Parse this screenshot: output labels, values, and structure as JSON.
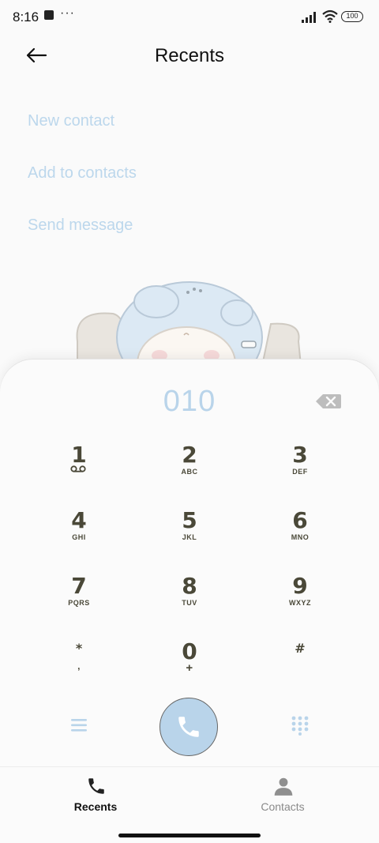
{
  "status_bar": {
    "time": "8:16",
    "more": "···",
    "battery": "100"
  },
  "header": {
    "title": "Recents",
    "back_icon": "arrow-left-icon"
  },
  "actions": [
    {
      "label": "New contact"
    },
    {
      "label": "Add to contacts"
    },
    {
      "label": "Send message"
    }
  ],
  "dialer": {
    "number": "010",
    "keys": [
      {
        "digit": "1",
        "sub": "",
        "icon": "voicemail-icon"
      },
      {
        "digit": "2",
        "sub": "ABC"
      },
      {
        "digit": "3",
        "sub": "DEF"
      },
      {
        "digit": "4",
        "sub": "GHI"
      },
      {
        "digit": "5",
        "sub": "JKL"
      },
      {
        "digit": "6",
        "sub": "MNO"
      },
      {
        "digit": "7",
        "sub": "PQRS"
      },
      {
        "digit": "8",
        "sub": "TUV"
      },
      {
        "digit": "9",
        "sub": "WXYZ"
      },
      {
        "digit": "*",
        "sub": ","
      },
      {
        "digit": "0",
        "sub": "+"
      },
      {
        "digit": "#",
        "sub": ""
      }
    ],
    "icons": {
      "backspace": "backspace-icon",
      "menu": "menu-icon",
      "call": "phone-icon",
      "dialpad": "dialpad-icon"
    }
  },
  "bottom_nav": [
    {
      "label": "Recents",
      "icon": "phone-icon",
      "active": true
    },
    {
      "label": "Contacts",
      "icon": "person-icon",
      "active": false
    }
  ],
  "colors": {
    "accent": "#b9d4ea",
    "key_text": "#4a4838",
    "link": "#bcd7ec"
  }
}
